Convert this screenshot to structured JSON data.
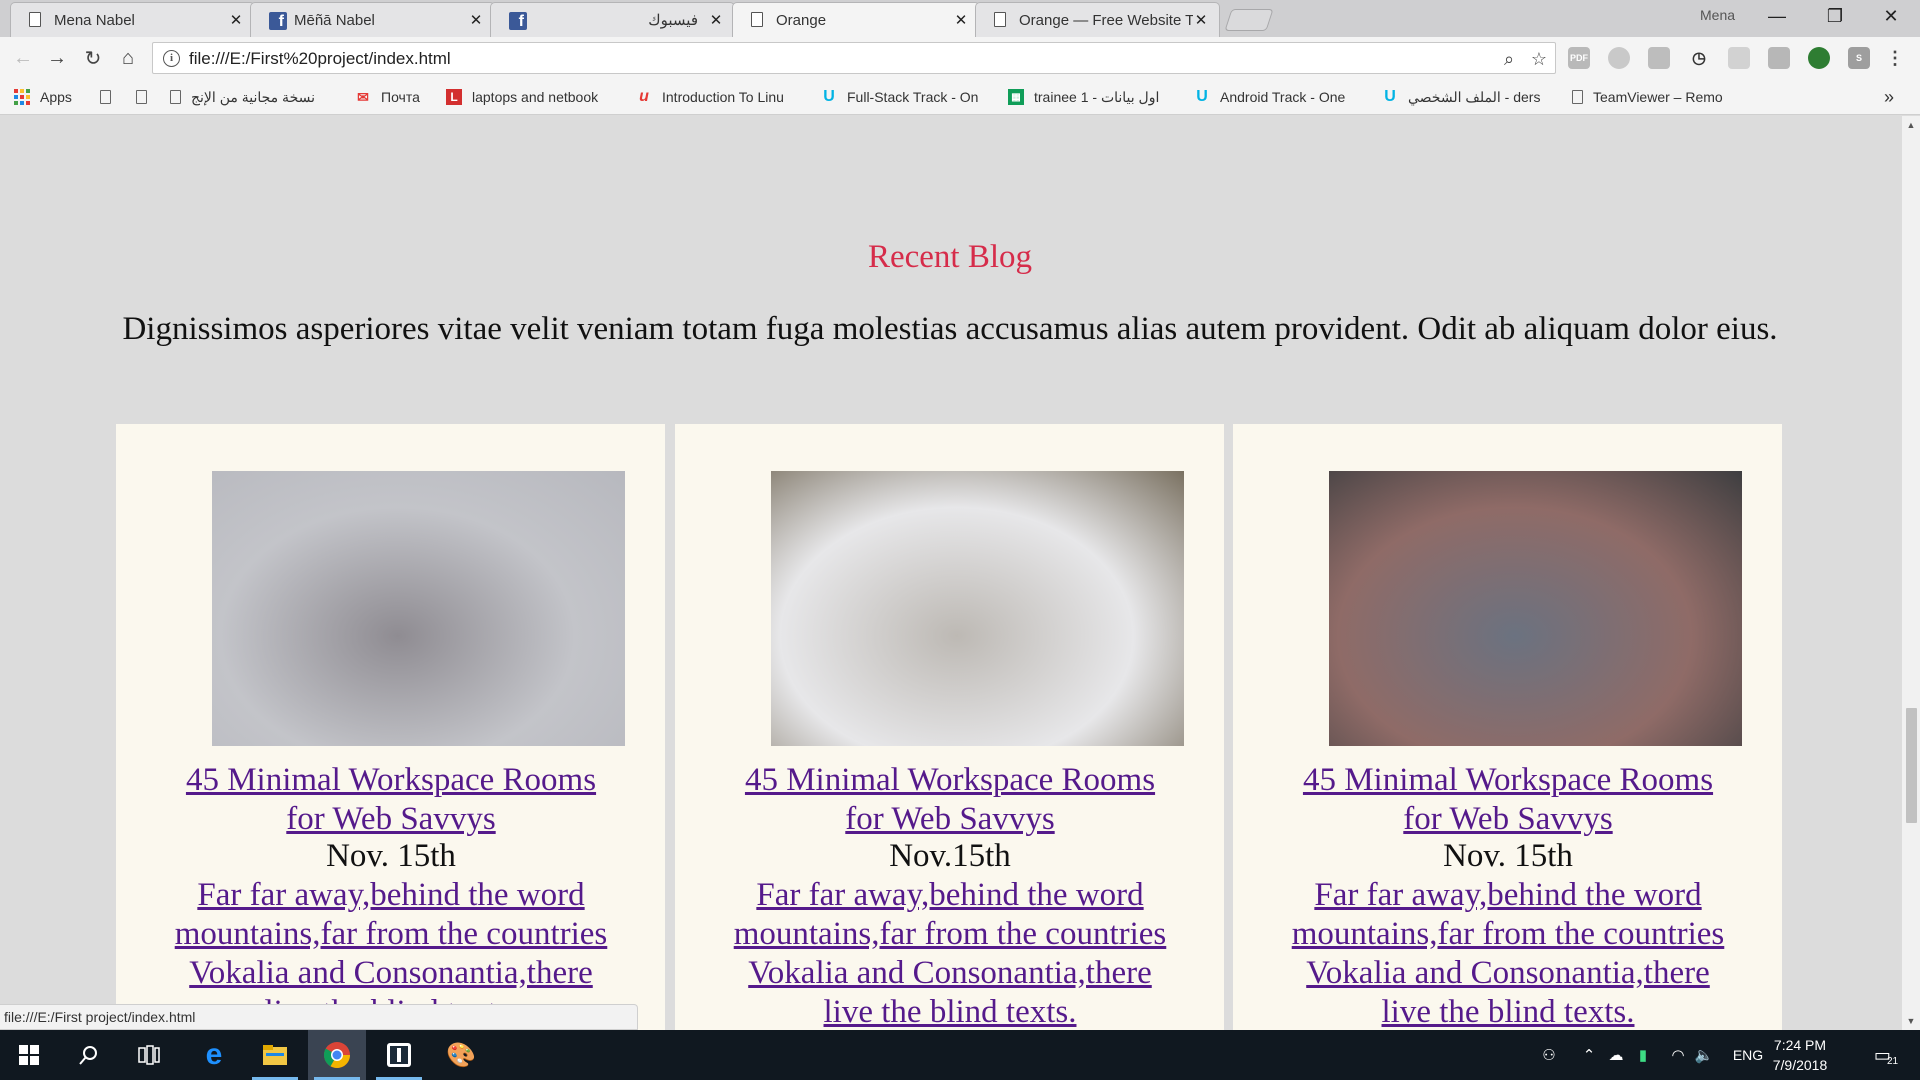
{
  "browser": {
    "tabs": [
      {
        "title": "Mena Nabel",
        "icon": "document-icon",
        "active": false
      },
      {
        "title": "Mēñā Nabel",
        "icon": "facebook-icon",
        "active": false
      },
      {
        "title": "فيسبوك",
        "icon": "facebook-icon",
        "active": false
      },
      {
        "title": "Orange",
        "icon": "document-icon",
        "active": true
      },
      {
        "title": "Orange — Free Website T",
        "icon": "document-icon",
        "active": false
      }
    ],
    "close_glyph": "✕",
    "profile_name": "Mena",
    "window_controls": {
      "minimize": "—",
      "restore": "❐",
      "close": "✕"
    },
    "url": "file:///E:/First%20project/index.html",
    "info_glyph": "i",
    "extension_labels": {
      "pdf": "PDF",
      "s": "S"
    },
    "bookmarks": [
      {
        "label": "Apps",
        "icon": "apps-grid-icon"
      },
      {
        "label": "",
        "icon": "document-icon"
      },
      {
        "label": "",
        "icon": "document-icon"
      },
      {
        "label": "نسخة مجانية من الإنج",
        "icon": "document-icon"
      },
      {
        "label": "Почта",
        "icon": "mail-icon"
      },
      {
        "label": "laptops and netbook",
        "icon": "l-logo-icon",
        "icon_text": "L"
      },
      {
        "label": "Introduction To Linu",
        "icon": "udacity-icon",
        "icon_text": "u"
      },
      {
        "label": "Full-Stack Track - On",
        "icon": "udacity-icon",
        "icon_text": "U"
      },
      {
        "label": "trainee 1 - اول بيانات",
        "icon": "sheets-icon"
      },
      {
        "label": "Android Track - One",
        "icon": "udacity-icon",
        "icon_text": "U"
      },
      {
        "label": "الملف الشخصي - ders",
        "icon": "udacity-icon",
        "icon_text": "U"
      },
      {
        "label": "TeamViewer – Remo",
        "icon": "document-icon"
      }
    ],
    "bookmarks_overflow": "»",
    "status_url": "file:///E:/First project/index.html"
  },
  "page": {
    "section_title": "Recent Blog",
    "section_desc": "Dignissimos asperiores vitae velit veniam totam fuga molestias accusamus alias autem provident. Odit ab aliquam dolor eius.",
    "cards": [
      {
        "title": "45 Minimal Workspace Rooms for Web Savvys",
        "date": "Nov. 15th",
        "text": "Far far away,behind the word mountains,far from the countries Vokalia and Consonantia,there live the blind texts.",
        "img_colors": [
          "#c3c4c9",
          "#8f8c92",
          "#b7b8be"
        ]
      },
      {
        "title": "45 Minimal Workspace Rooms for Web Savvys",
        "date": "Nov.15th",
        "text": "Far far away,behind the word mountains,far from the countries Vokalia and Consonantia,there live the blind texts.",
        "img_colors": [
          "#e7e7e9",
          "#bdb9b4",
          "#7a7161"
        ]
      },
      {
        "title": "45 Minimal Workspace Rooms for Web Savvys",
        "date": "Nov. 15th",
        "text": "Far far away,behind the word mountains,far from the countries Vokalia and Consonantia,there live the blind texts.",
        "img_colors": [
          "#8f6b67",
          "#6b7280",
          "#3e3e40"
        ]
      }
    ]
  },
  "taskbar": {
    "items": [
      "windows-start-icon",
      "search-icon",
      "task-view-icon",
      "edge-icon",
      "file-explorer-icon",
      "chrome-icon",
      "app-icon",
      "paint-icon"
    ],
    "language": "ENG",
    "time": "7:24 PM",
    "date": "7/9/2018",
    "notifications_count": "21"
  },
  "colors": {
    "accent_title": "#d62c4a",
    "link_visited": "#551a8b",
    "card_bg": "#fbf8ee",
    "page_bg": "#dcdcdc"
  }
}
